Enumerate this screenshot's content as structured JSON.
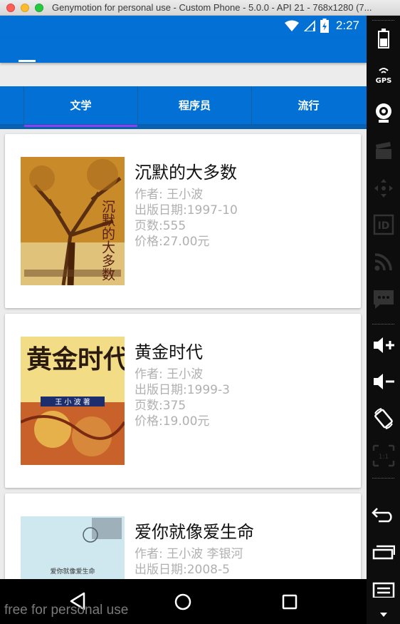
{
  "window": {
    "title": "Genymotion for personal use - Custom Phone - 5.0.0 - API 21 - 768x1280 (7..."
  },
  "statusbar": {
    "time": "2:27"
  },
  "tabs": [
    {
      "label": "文学",
      "active": true
    },
    {
      "label": "程序员",
      "active": false
    },
    {
      "label": "流行",
      "active": false
    }
  ],
  "books": [
    {
      "title": "沉默的大多数",
      "author": "作者: 王小波",
      "date": "出版日期:1997-10",
      "pages": "页数:555",
      "price": "价格:27.00元",
      "cover_text": "沉默的大多数"
    },
    {
      "title": "黄金时代",
      "author": "作者: 王小波",
      "date": "出版日期:1999-3",
      "pages": "页数:375",
      "price": "价格:19.00元",
      "cover_text": "黄金时代",
      "cover_sub": "王 小 波 著"
    },
    {
      "title": "爱你就像爱生命",
      "author": "作者: 王小波 李银河",
      "date": "出版日期:2008-5",
      "cover_text": "爱你就像爱生命"
    }
  ],
  "watermark": "free for personal use",
  "sidebar_icons": [
    "battery-icon",
    "gps-icon",
    "camera-icon",
    "video-icon",
    "dpad-icon",
    "id-icon",
    "rss-icon",
    "sms-icon",
    "volume-up-icon",
    "volume-down-icon",
    "rotate-icon",
    "scale-icon",
    "back-icon",
    "recent-apps-icon",
    "menu-icon"
  ],
  "sidebar_labels": {
    "gps": "GPS",
    "id": "ID",
    "scale": "1:1"
  },
  "colors": {
    "primary": "#0270d4",
    "tab_indicator": "#8e3ff0",
    "meta_text": "#b0b0b0"
  }
}
